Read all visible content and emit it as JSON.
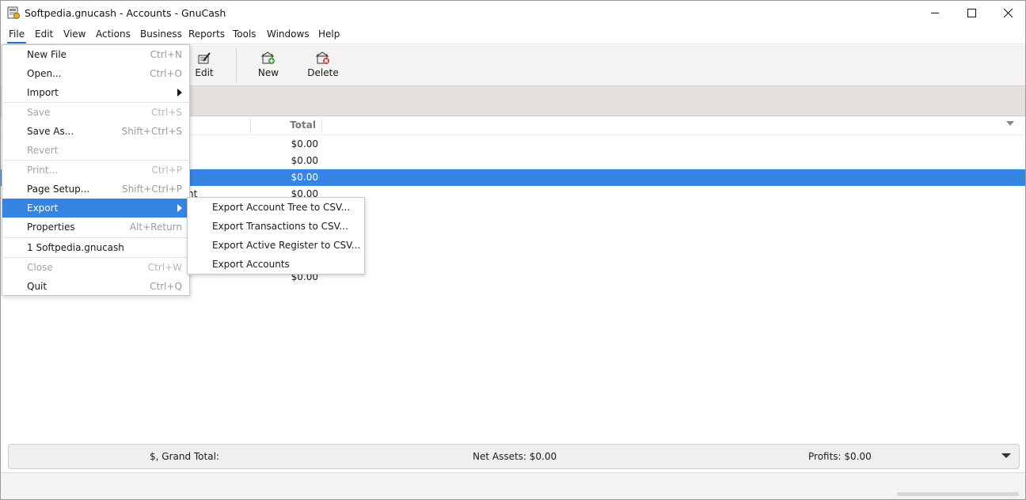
{
  "window": {
    "title": "Softpedia.gnucash - Accounts - GnuCash"
  },
  "menubar": {
    "items": [
      "File",
      "Edit",
      "View",
      "Actions",
      "Business",
      "Reports",
      "Tools",
      "Windows",
      "Help"
    ]
  },
  "toolbar": {
    "edit_label": "Edit",
    "new_label": "New",
    "delete_label": "Delete"
  },
  "columns": {
    "total": "Total"
  },
  "rows": [
    {
      "name_tail": "",
      "total": "$0.00"
    },
    {
      "name_tail": "",
      "total": "$0.00"
    },
    {
      "name_tail": "",
      "total": "$0.00"
    },
    {
      "name_tail": "nt",
      "total": "$0.00"
    },
    {
      "name_tail": "",
      "total": "$0.00"
    }
  ],
  "file_menu": {
    "items": [
      {
        "label": "New File",
        "shortcut": "Ctrl+N"
      },
      {
        "label": "Open...",
        "shortcut": "Ctrl+O"
      },
      {
        "label": "Import",
        "shortcut": ""
      },
      {
        "label": "Save",
        "shortcut": "Ctrl+S"
      },
      {
        "label": "Save As...",
        "shortcut": "Shift+Ctrl+S"
      },
      {
        "label": "Revert",
        "shortcut": ""
      },
      {
        "label": "Print...",
        "shortcut": "Ctrl+P"
      },
      {
        "label": "Page Setup...",
        "shortcut": "Shift+Ctrl+P"
      },
      {
        "label": "Export",
        "shortcut": ""
      },
      {
        "label": "Properties",
        "shortcut": "Alt+Return"
      },
      {
        "label": "1 Softpedia.gnucash",
        "shortcut": ""
      },
      {
        "label": "Close",
        "shortcut": "Ctrl+W"
      },
      {
        "label": "Quit",
        "shortcut": "Ctrl+Q"
      }
    ]
  },
  "export_menu": {
    "items": [
      {
        "label": "Export Account Tree to CSV..."
      },
      {
        "label": "Export Transactions to CSV..."
      },
      {
        "label": "Export Active Register to CSV..."
      },
      {
        "label": "Export Accounts"
      }
    ]
  },
  "summary": {
    "grand_total": "$, Grand Total:",
    "net_assets": "Net Assets: $0.00",
    "profits": "Profits: $0.00"
  },
  "colors": {
    "accent": "#3584e4",
    "menu_underline": "#2f6fd0"
  }
}
